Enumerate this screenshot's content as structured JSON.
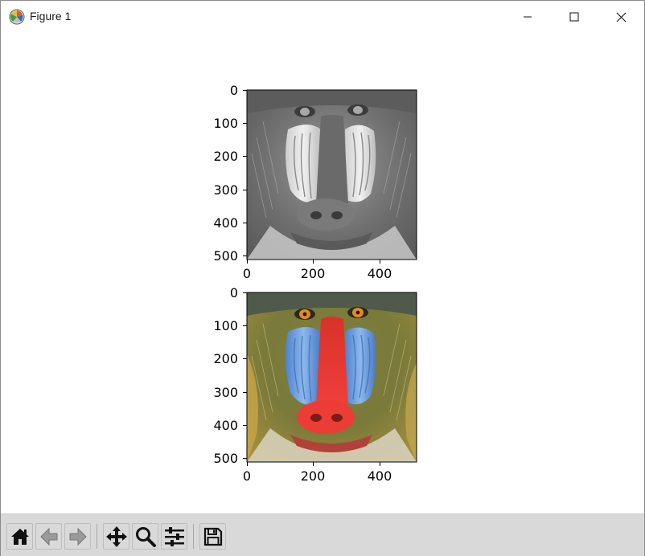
{
  "window": {
    "title": "Figure 1",
    "controls": [
      "minimize",
      "maximize",
      "close"
    ]
  },
  "chart_data": [
    {
      "type": "image",
      "title": "",
      "colormap": "gray",
      "image_shape": [
        512,
        512
      ],
      "xlim": [
        0,
        512
      ],
      "ylim": [
        512,
        0
      ],
      "x_ticks": [
        "0",
        "200",
        "400"
      ],
      "y_ticks": [
        "0",
        "100",
        "200",
        "300",
        "400",
        "500"
      ],
      "x_tick_values": [
        0,
        200,
        400
      ],
      "y_tick_values": [
        0,
        100,
        200,
        300,
        400,
        500
      ],
      "content": "grayscale mandrill"
    },
    {
      "type": "image",
      "title": "",
      "colormap": "rgb",
      "image_shape": [
        512,
        512
      ],
      "xlim": [
        0,
        512
      ],
      "ylim": [
        512,
        0
      ],
      "x_ticks": [
        "0",
        "200",
        "400"
      ],
      "y_ticks": [
        "0",
        "100",
        "200",
        "300",
        "400",
        "500"
      ],
      "x_tick_values": [
        0,
        200,
        400
      ],
      "y_tick_values": [
        0,
        100,
        200,
        300,
        400,
        500
      ],
      "content": "color mandrill"
    }
  ],
  "toolbar": {
    "buttons": [
      "home-icon",
      "back-icon",
      "forward-icon",
      "pan-icon",
      "zoom-icon",
      "configure-subplots-icon",
      "save-icon"
    ]
  },
  "colors": {
    "toolbar_bg": "#d9d9d9",
    "nose_red": "#e8352c",
    "cheek_blue": "#5b8fd6",
    "fur_olive": "#8a8a3a",
    "eye_orange": "#e88a1a"
  }
}
